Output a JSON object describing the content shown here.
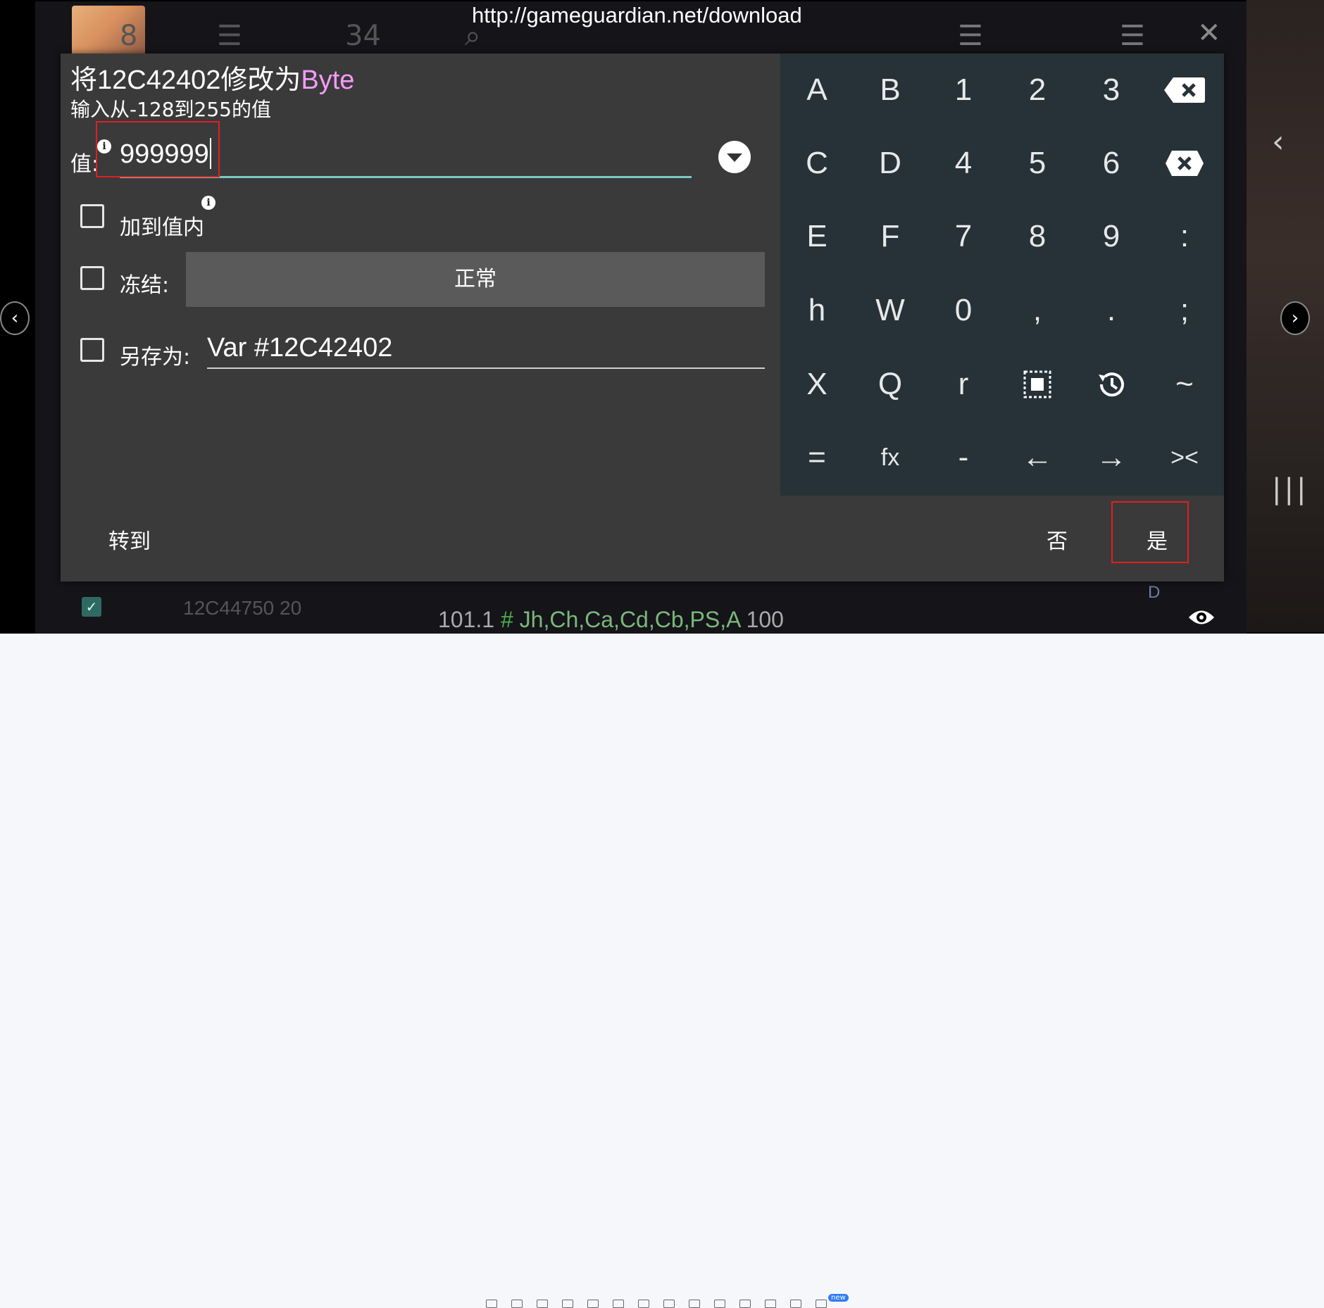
{
  "banner": {
    "url": "http://gameguardian.net/download"
  },
  "dialog": {
    "title_prefix": "将12C42402修改为",
    "title_type": "Byte",
    "subtitle": "输入从-128到255的值",
    "value_label": "值:",
    "value": "999999",
    "add_to_value_label": "加到值内",
    "freeze_label": "冻结:",
    "freeze_mode": "正常",
    "save_as_label": "另存为:",
    "save_as_value": "Var #12C42402",
    "goto_label": "转到",
    "no_label": "否",
    "yes_label": "是"
  },
  "keypad": {
    "rows": [
      [
        "A",
        "B",
        "1",
        "2",
        "3",
        "backspace-icon"
      ],
      [
        "C",
        "D",
        "4",
        "5",
        "6",
        "clear-icon"
      ],
      [
        "E",
        "F",
        "7",
        "8",
        "9",
        ":"
      ],
      [
        "h",
        "W",
        "0",
        ",",
        ".",
        ";"
      ],
      [
        "X",
        "Q",
        "r",
        "select-all-icon",
        "history-icon",
        "~"
      ],
      [
        "=",
        "fx",
        "-",
        "←",
        "→",
        "><"
      ]
    ]
  },
  "status_bar": {
    "value": "101.1",
    "hash": "#",
    "flags": "Jh,Ch,Ca,Cd,Cb,PS,A",
    "count": "100"
  },
  "game_bg": {
    "num1": "8",
    "num2": "34",
    "row_letter": "D",
    "row_text": "12C44750   20"
  },
  "viewer": {
    "new_badge": "new"
  },
  "colors": {
    "dialog_bg": "#3a3a3a",
    "keypad_bg": "#263238",
    "accent_line": "#78cbc0",
    "type_pink": "#f39cf8",
    "highlight_red": "#e02020"
  }
}
